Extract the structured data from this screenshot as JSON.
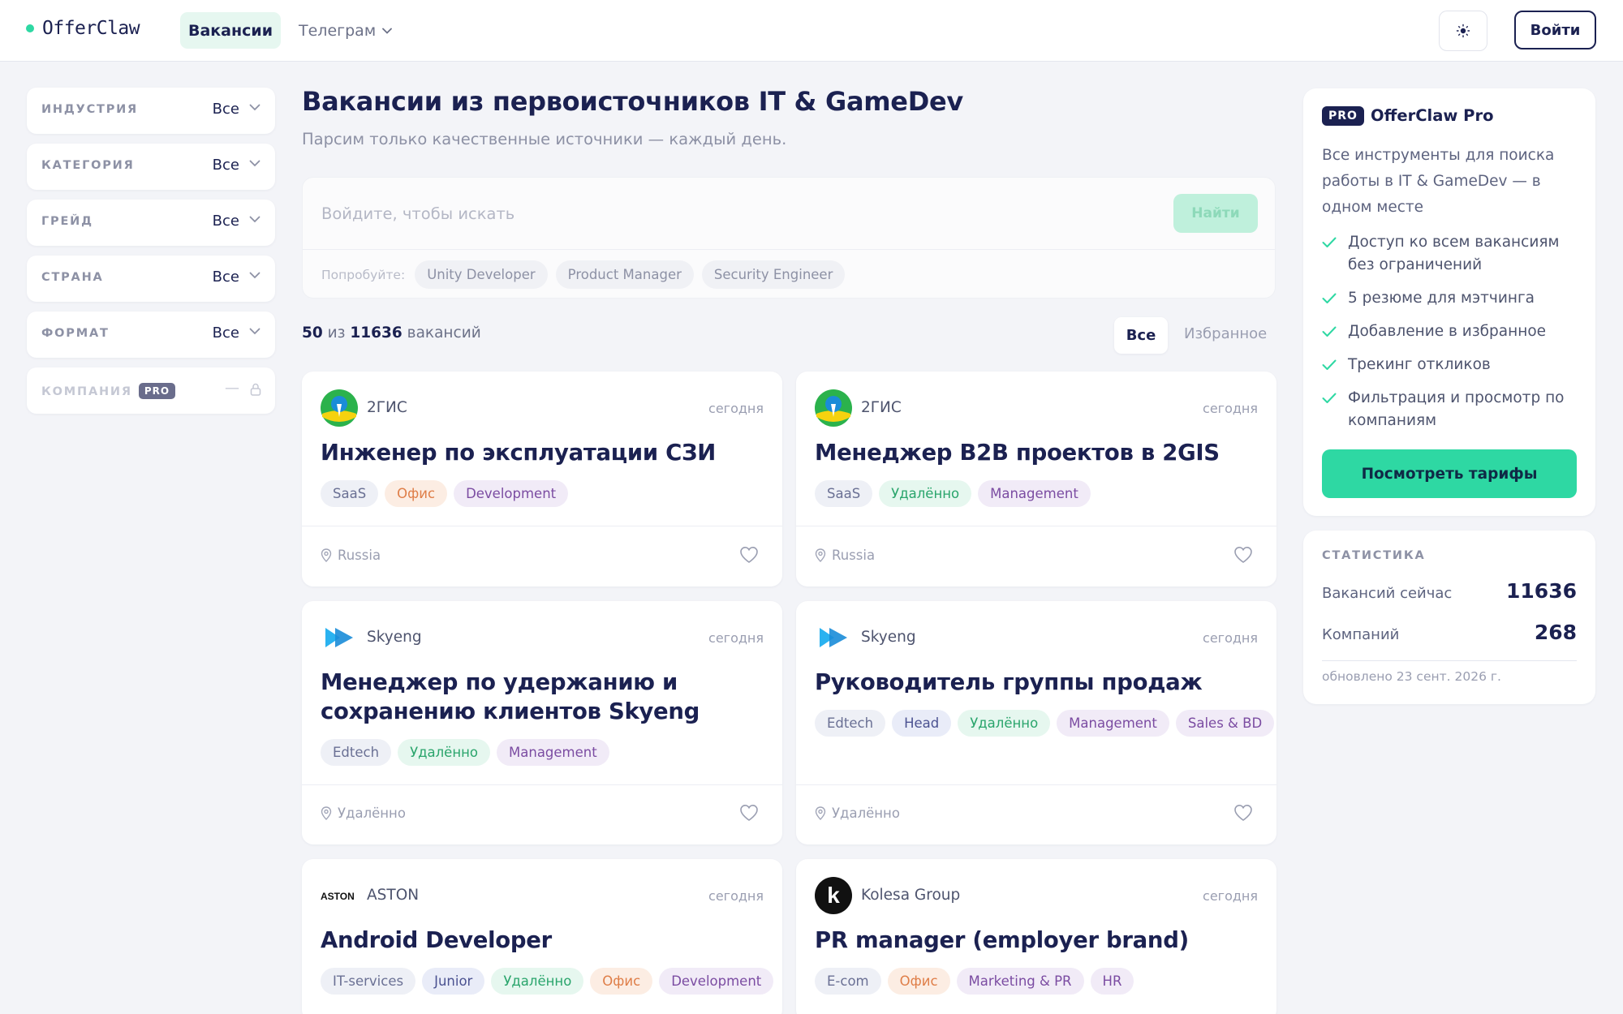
{
  "header": {
    "logo": "OfferClaw",
    "nav_vacancies": "Вакансии",
    "nav_telegram": "Телеграм",
    "login": "Войти"
  },
  "filters": [
    {
      "label": "Индустрия",
      "value": "Все"
    },
    {
      "label": "Категория",
      "value": "Все"
    },
    {
      "label": "Грейд",
      "value": "Все"
    },
    {
      "label": "Страна",
      "value": "Все"
    },
    {
      "label": "Формат",
      "value": "Все"
    }
  ],
  "company_filter": {
    "label": "Компания",
    "badge": "PRO",
    "value": "—"
  },
  "main": {
    "title": "Вакансии из первоисточников IT & GameDev",
    "subtitle": "Парсим только качественные источники — каждый день.",
    "search_placeholder": "Войдите, чтобы искать",
    "search_button": "Найти",
    "try_label": "Попробуйте:",
    "suggestions": [
      "Unity Developer",
      "Product Manager",
      "Security Engineer"
    ],
    "count_shown": "50",
    "count_of": "из",
    "count_total": "11636",
    "count_suffix": "вакансий",
    "tab_all": "Все",
    "tab_favorites": "Избранное"
  },
  "cards": [
    {
      "company": "2ГИС",
      "date": "сегодня",
      "title": "Инженер по эксплуатации СЗИ",
      "tags": [
        {
          "text": "SaaS",
          "color": "gray"
        },
        {
          "text": "Офис",
          "color": "orange"
        },
        {
          "text": "Development",
          "color": "purple"
        }
      ],
      "location": "Russia"
    },
    {
      "company": "2ГИС",
      "date": "сегодня",
      "title": "Менеджер B2B проектов в 2GIS",
      "tags": [
        {
          "text": "SaaS",
          "color": "gray"
        },
        {
          "text": "Удалённо",
          "color": "green"
        },
        {
          "text": "Management",
          "color": "purple"
        }
      ],
      "location": "Russia"
    },
    {
      "company": "Skyeng",
      "date": "сегодня",
      "title": "Менеджер по удержанию и сохранению клиентов Skyeng",
      "tags": [
        {
          "text": "Edtech",
          "color": "gray"
        },
        {
          "text": "Удалённо",
          "color": "green"
        },
        {
          "text": "Management",
          "color": "purple"
        }
      ],
      "location": "Удалённо"
    },
    {
      "company": "Skyeng",
      "date": "сегодня",
      "title": "Руководитель группы продаж",
      "tags": [
        {
          "text": "Edtech",
          "color": "gray"
        },
        {
          "text": "Head",
          "color": "blue"
        },
        {
          "text": "Удалённо",
          "color": "green"
        },
        {
          "text": "Management",
          "color": "purple"
        },
        {
          "text": "Sales & BD",
          "color": "purple"
        }
      ],
      "location": "Удалённо"
    },
    {
      "company": "ASTON",
      "logo_text": "ASTON",
      "date": "сегодня",
      "title": "Android Developer",
      "tags": [
        {
          "text": "IT-services",
          "color": "gray"
        },
        {
          "text": "Junior",
          "color": "blue"
        },
        {
          "text": "Удалённо",
          "color": "green"
        },
        {
          "text": "Офис",
          "color": "orange"
        },
        {
          "text": "Development",
          "color": "purple"
        }
      ]
    },
    {
      "company": "Kolesa Group",
      "logo_text": "k",
      "date": "сегодня",
      "title": "PR manager (employer brand)",
      "tags": [
        {
          "text": "E-com",
          "color": "gray"
        },
        {
          "text": "Офис",
          "color": "orange"
        },
        {
          "text": "Marketing & PR",
          "color": "purple"
        },
        {
          "text": "HR",
          "color": "purple"
        }
      ]
    }
  ],
  "pro": {
    "badge": "PRO",
    "title": "OfferClaw Pro",
    "description": "Все инструменты для поиска работы в IT & GameDev — в одном месте",
    "features": [
      "Доступ ко всем вакансиям без ограничений",
      "5 резюме для мэтчинга",
      "Добавление в избранное",
      "Трекинг откликов",
      "Фильтрация и просмотр по компаниям"
    ],
    "cta": "Посмотреть тарифы"
  },
  "stats": {
    "label": "СТАТИСТИКА",
    "vacancies_label": "Вакансий сейчас",
    "vacancies_value": "11636",
    "companies_label": "Компаний",
    "companies_value": "268",
    "updated": "обновлено 23 сент. 2026 г."
  },
  "colors": {
    "accent": "#2ed8a3",
    "navy": "#1b2151",
    "background": "#f3f4f8"
  }
}
